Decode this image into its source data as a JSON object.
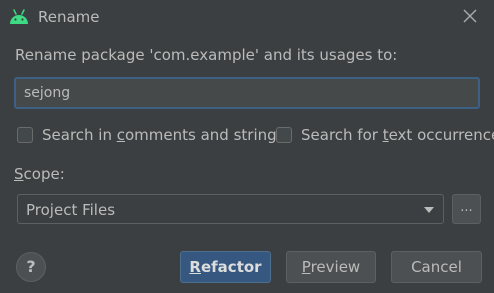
{
  "window": {
    "title": "Rename",
    "app_icon": "android-icon",
    "close_icon": "close-icon"
  },
  "dialog": {
    "prompt": "Rename package 'com.example' and its usages to:",
    "new_name_value": "sejong",
    "options": {
      "search_comments_label_pre": "Search in ",
      "search_comments_label_mn": "c",
      "search_comments_label_post": "omments and strings",
      "search_comments_checked": false,
      "search_text_label_pre": "Search for ",
      "search_text_label_mn": "t",
      "search_text_label_post": "ext occurrences",
      "search_text_checked": false
    },
    "scope": {
      "label_mn": "S",
      "label_rest": "cope:",
      "selected": "Project Files",
      "more_button": "..."
    }
  },
  "buttons": {
    "help": "?",
    "refactor_mn": "R",
    "refactor_rest": "efactor",
    "preview_mn": "P",
    "preview_rest": "review",
    "cancel": "Cancel"
  },
  "colors": {
    "background": "#3c3f41",
    "text": "#bbbbbb",
    "accent": "#365880",
    "focus_border": "#3d6185",
    "android_green": "#3ddc84"
  }
}
